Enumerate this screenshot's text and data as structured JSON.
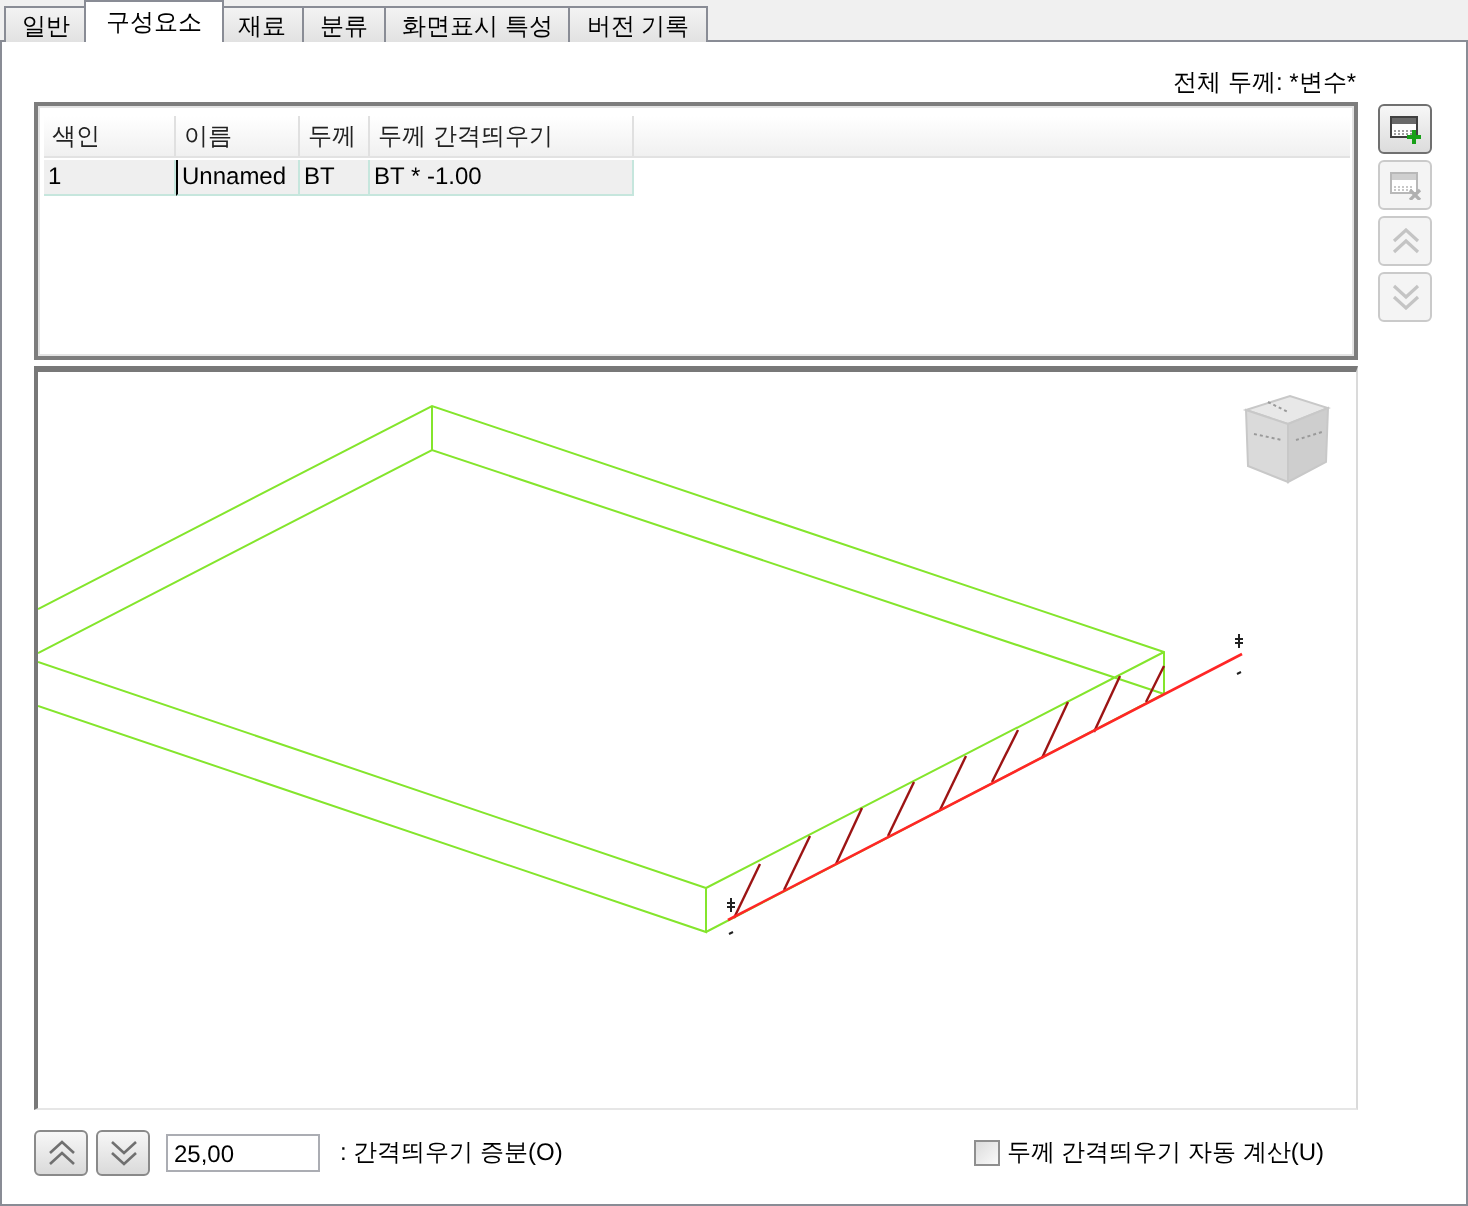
{
  "tabs": [
    {
      "label": "일반",
      "selected": false
    },
    {
      "label": "구성요소",
      "selected": true
    },
    {
      "label": "재료",
      "selected": false
    },
    {
      "label": "분류",
      "selected": false
    },
    {
      "label": "화면표시 특성",
      "selected": false
    },
    {
      "label": "버전 기록",
      "selected": false
    }
  ],
  "total_thickness": "전체 두께: *변수*",
  "table": {
    "columns": [
      "색인",
      "이름",
      "두께",
      "두께 간격띄우기"
    ],
    "rows": [
      {
        "selected": true,
        "cells": [
          {
            "text": "1",
            "editing": false
          },
          {
            "text": "Unnamed",
            "editing": true
          },
          {
            "text": "BT",
            "editing": false
          },
          {
            "text": "BT * -1.00",
            "editing": false
          }
        ]
      }
    ]
  },
  "side_buttons": [
    {
      "kind": "add",
      "disabled": false
    },
    {
      "kind": "delete",
      "disabled": true
    },
    {
      "kind": "move_up",
      "disabled": true
    },
    {
      "kind": "move_down",
      "disabled": true
    }
  ],
  "step_buttons": [
    {
      "kind": "up"
    },
    {
      "kind": "down"
    }
  ],
  "increment": {
    "value": "25,00",
    "label": ": 간격띄우기 증분(O)"
  },
  "auto_calc": {
    "label": "두께 간격띄우기 자동 계산(U)",
    "checked": false
  }
}
